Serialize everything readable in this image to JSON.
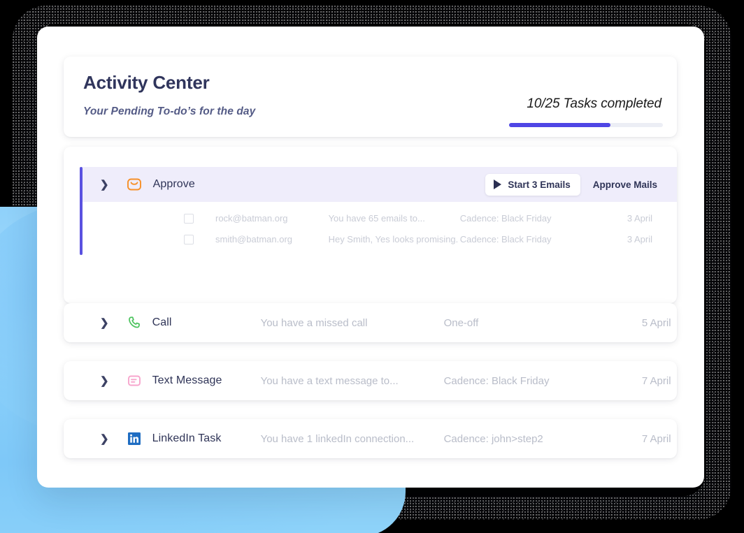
{
  "header": {
    "title": "Activity Center",
    "subtitle": "Your Pending To-do’s for the day",
    "progress_label": "10/25 Tasks completed",
    "progress_completed": 10,
    "progress_total": 25,
    "progress_percent": 66,
    "accent_color": "#4f46e5",
    "track_color": "#eceef5"
  },
  "approve_group": {
    "chevron_icon": "chevron-right-icon",
    "icon": "envelope-icon",
    "icon_color": "#f79029",
    "title": "Approve",
    "start_button": {
      "label": "Start 3 Emails",
      "icon": "play-icon"
    },
    "approve_button_label": "Approve Mails",
    "accent_bar_color": "#5a52e0",
    "header_background": "#efedfb",
    "rows": [
      {
        "checkbox_checked": false,
        "email": "rock@batman.org",
        "preview": "You have 65 emails to...",
        "cadence": "Cadence: Black Friday",
        "date": "3 April"
      },
      {
        "checkbox_checked": false,
        "email": "smith@batman.org",
        "preview": "Hey Smith, Yes looks promising.",
        "cadence": "Cadence: Black Friday",
        "date": "3 April"
      }
    ]
  },
  "tasks": [
    {
      "chevron_icon": "chevron-right-icon",
      "icon": "phone-icon",
      "icon_color": "#4cc35e",
      "title": "Call",
      "description": "You have a missed call",
      "cadence": "One-off",
      "date": "5 April"
    },
    {
      "chevron_icon": "chevron-right-icon",
      "icon": "message-icon",
      "icon_color": "#f7a6cd",
      "title": "Text Message",
      "description": "You have a text message to...",
      "cadence": "Cadence: Black Friday",
      "date": "7 April"
    },
    {
      "chevron_icon": "chevron-right-icon",
      "icon": "linkedin-icon",
      "icon_color": "#1f6dc2",
      "title": "LinkedIn Task",
      "description": "You have 1 linkedIn connection...",
      "cadence": "Cadence: john>step2",
      "date": "7 April"
    }
  ]
}
